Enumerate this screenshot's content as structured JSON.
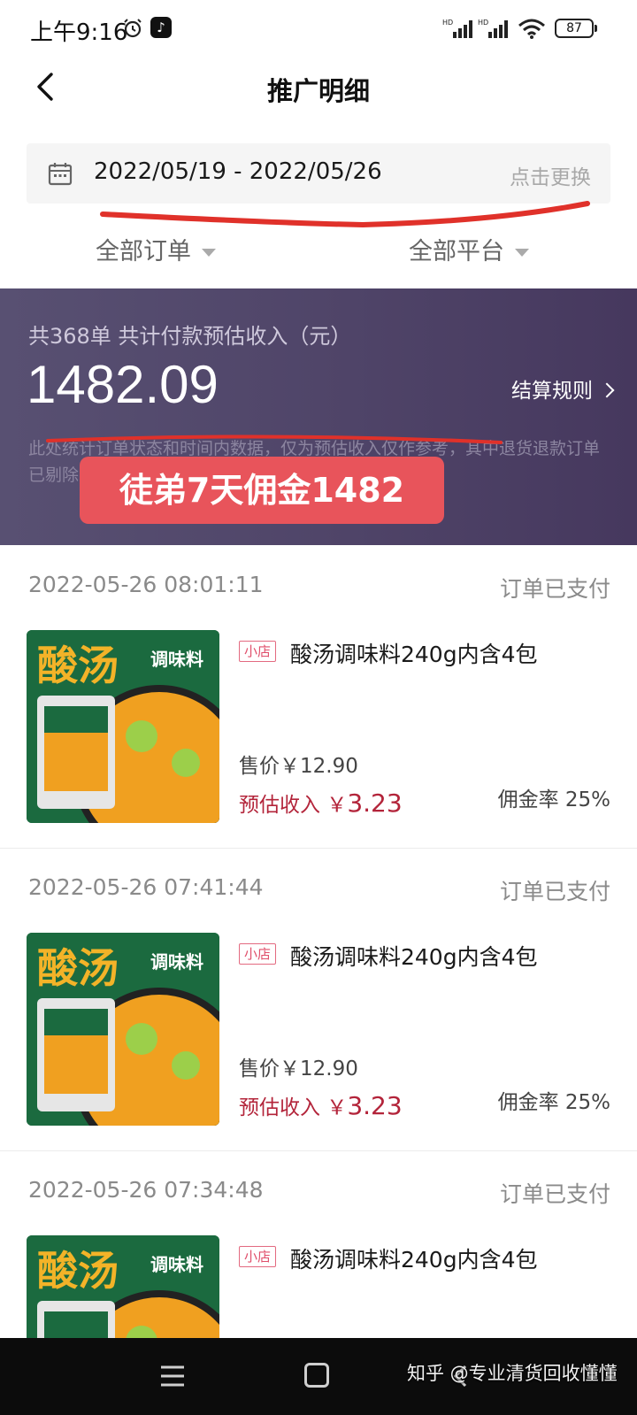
{
  "status_bar": {
    "time": "上午9:16",
    "battery": "87"
  },
  "header": {
    "title": "推广明细"
  },
  "date_filter": {
    "range": "2022/05/19 - 2022/05/26",
    "change_label": "点击更换"
  },
  "filters": {
    "orders": "全部订单",
    "platforms": "全部平台"
  },
  "summary": {
    "caption": "共368单 共计付款预估收入（元）",
    "amount": "1482.09",
    "rules_link": "结算规则",
    "note": "此处统计订单状态和时间内数据，仅为预估收入仅作参考，其中退货退款订单已剔除，淘宝联盟收益请到淘宝联盟查看",
    "overlay_text": "徒弟7天佣金1482"
  },
  "orders": [
    {
      "time": "2022-05-26 08:01:11",
      "status": "订单已支付",
      "shop_tag": "小店",
      "product": "酸汤调味料240g内含4包",
      "price": "售价￥12.90",
      "income_label": "预估收入 ￥",
      "income_value": "3.23",
      "commission": "佣金率 25%",
      "image_text": "酸汤",
      "image_subtext": "调味料"
    },
    {
      "time": "2022-05-26 07:41:44",
      "status": "订单已支付",
      "shop_tag": "小店",
      "product": "酸汤调味料240g内含4包",
      "price": "售价￥12.90",
      "income_label": "预估收入 ￥",
      "income_value": "3.23",
      "commission": "佣金率 25%",
      "image_text": "酸汤",
      "image_subtext": "调味料"
    },
    {
      "time": "2022-05-26 07:34:48",
      "status": "订单已支付",
      "shop_tag": "小店",
      "product": "酸汤调味料240g内含4包",
      "image_text": "酸汤",
      "image_subtext": "调味料"
    }
  ],
  "watermark": "知乎 @专业清货回收懂懂",
  "colors": {
    "summary_bg": "#4f4468",
    "income_red": "#b3243a",
    "overlay_red": "#e8545b",
    "product_green": "#1b6a3f",
    "product_orange": "#f0a020"
  },
  "icons": [
    "alarm-icon",
    "tiktok-icon",
    "signal-icon",
    "wifi-icon",
    "back-icon",
    "calendar-icon",
    "menu-icon",
    "home-icon",
    "nav-back-icon"
  ]
}
